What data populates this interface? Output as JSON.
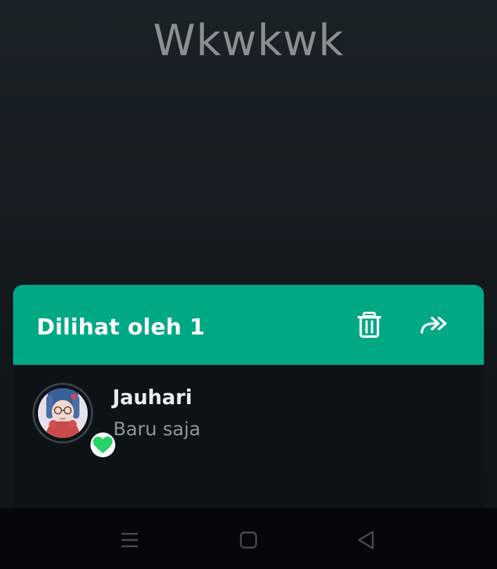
{
  "status": {
    "caption": "Wkwkwk"
  },
  "viewers_sheet": {
    "title": "Dilihat oleh 1",
    "actions": [
      {
        "icon": "trash-icon"
      },
      {
        "icon": "forward-icon"
      }
    ],
    "viewers": [
      {
        "name": "Jauhari",
        "time": "Baru saja",
        "reaction_icon": "heart-icon"
      }
    ]
  },
  "navigation": {
    "buttons": [
      {
        "icon": "menu-icon"
      },
      {
        "icon": "home-square-icon"
      },
      {
        "icon": "back-triangle-icon"
      }
    ]
  },
  "colors": {
    "header_green": "#00a884",
    "heart_green": "#25d366",
    "sheet_bg": "#0c1216",
    "nav_bg": "#050708"
  }
}
